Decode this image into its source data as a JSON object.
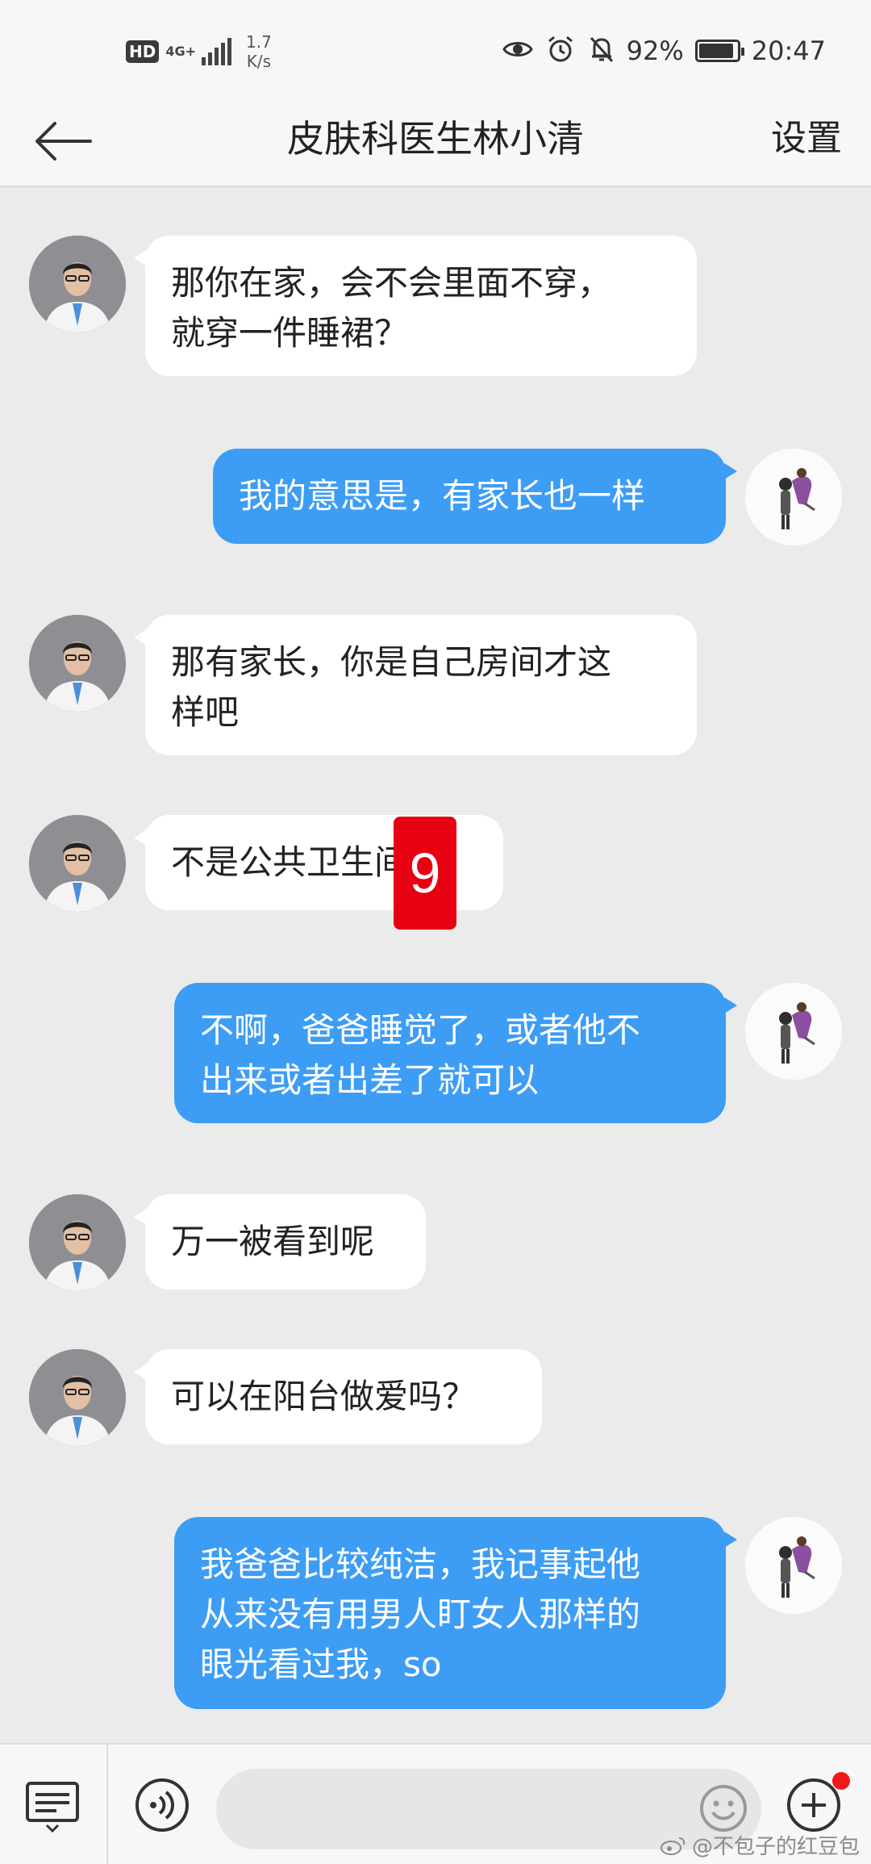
{
  "status_bar": {
    "hd": "HD",
    "network": "4G+",
    "speed_value": "1.7",
    "speed_unit": "K/s",
    "battery_percent": "92%",
    "battery_level": 0.92,
    "time": "20:47"
  },
  "header": {
    "title": "皮肤科医生林小清",
    "settings_label": "设置"
  },
  "messages": [
    {
      "from": "doctor",
      "lines": [
        "那你在家，会不会里面不穿，",
        "就穿一件睡裙？"
      ]
    },
    {
      "from": "me",
      "lines": [
        "我的意思是，有家长也一样"
      ]
    },
    {
      "from": "doctor",
      "lines": [
        "那有家长，你是自己房间才这",
        "样吧"
      ]
    },
    {
      "from": "doctor",
      "lines": [
        "不是公共卫生间吧"
      ]
    },
    {
      "from": "me",
      "lines": [
        "不啊，爸爸睡觉了，或者他不",
        "出来或者出差了就可以"
      ]
    },
    {
      "from": "doctor",
      "lines": [
        "万一被看到呢"
      ]
    },
    {
      "from": "doctor",
      "lines": [
        "可以在阳台做爱吗？"
      ]
    },
    {
      "from": "me",
      "lines": [
        "我爸爸比较纯洁，我记事起他",
        "从来没有用男人盯女人那样的",
        "眼光看过我，so"
      ]
    }
  ],
  "overlay_badge": "9",
  "watermark": "@不包子的红豆包",
  "colors": {
    "outgoing_bubble": "#3d9df5",
    "incoming_bubble": "#ffffff",
    "background": "#ebebeb",
    "badge": "#e60012",
    "notification_dot": "#f01919"
  },
  "icons": {
    "back": "arrow-left-icon",
    "menu": "keyboard-menu-icon",
    "voice": "voice-icon",
    "emoji": "emoji-icon",
    "plus": "plus-circle-icon"
  }
}
